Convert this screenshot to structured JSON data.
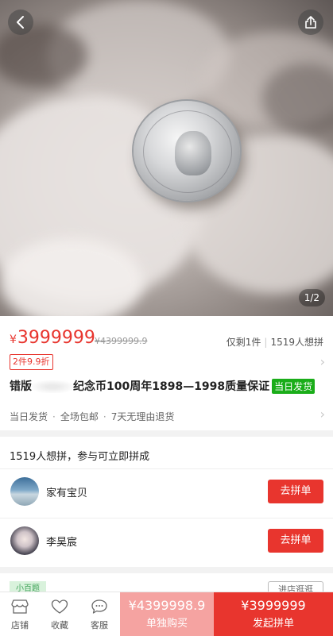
{
  "gallery": {
    "counter": "1/2",
    "image_alt": "silver commemorative coin on white fur"
  },
  "product": {
    "currency_symbol": "¥",
    "price": "3999999",
    "original_price": "¥4399999.9",
    "stock": "仅剩1件",
    "wanted_count": "1519人想拼",
    "discount_tag": "2件9.9折",
    "title_prefix": "错版",
    "title_rest": "纪念币100周年1898—1998质量保证",
    "badge": "当日发货",
    "services": [
      "当日发货",
      "全场包邮",
      "7天无理由退货"
    ]
  },
  "group_buy": {
    "heading": "1519人想拼，参与可立即拼成",
    "members": [
      {
        "name": "家有宝贝",
        "button": "去拼单"
      },
      {
        "name": "李昊宸",
        "button": "去拼单"
      }
    ]
  },
  "peek": {
    "tag": "小百题",
    "button": "进店逛逛"
  },
  "bottom_bar": {
    "store": "店铺",
    "favorite": "收藏",
    "service": "客服",
    "solo_price": "¥4399998.9",
    "solo_label": "单独购买",
    "group_price": "¥3999999",
    "group_label": "发起拼单"
  },
  "colors": {
    "accent": "#e8352e",
    "accent_light": "#f5a3a1",
    "badge_green": "#1aad19"
  }
}
